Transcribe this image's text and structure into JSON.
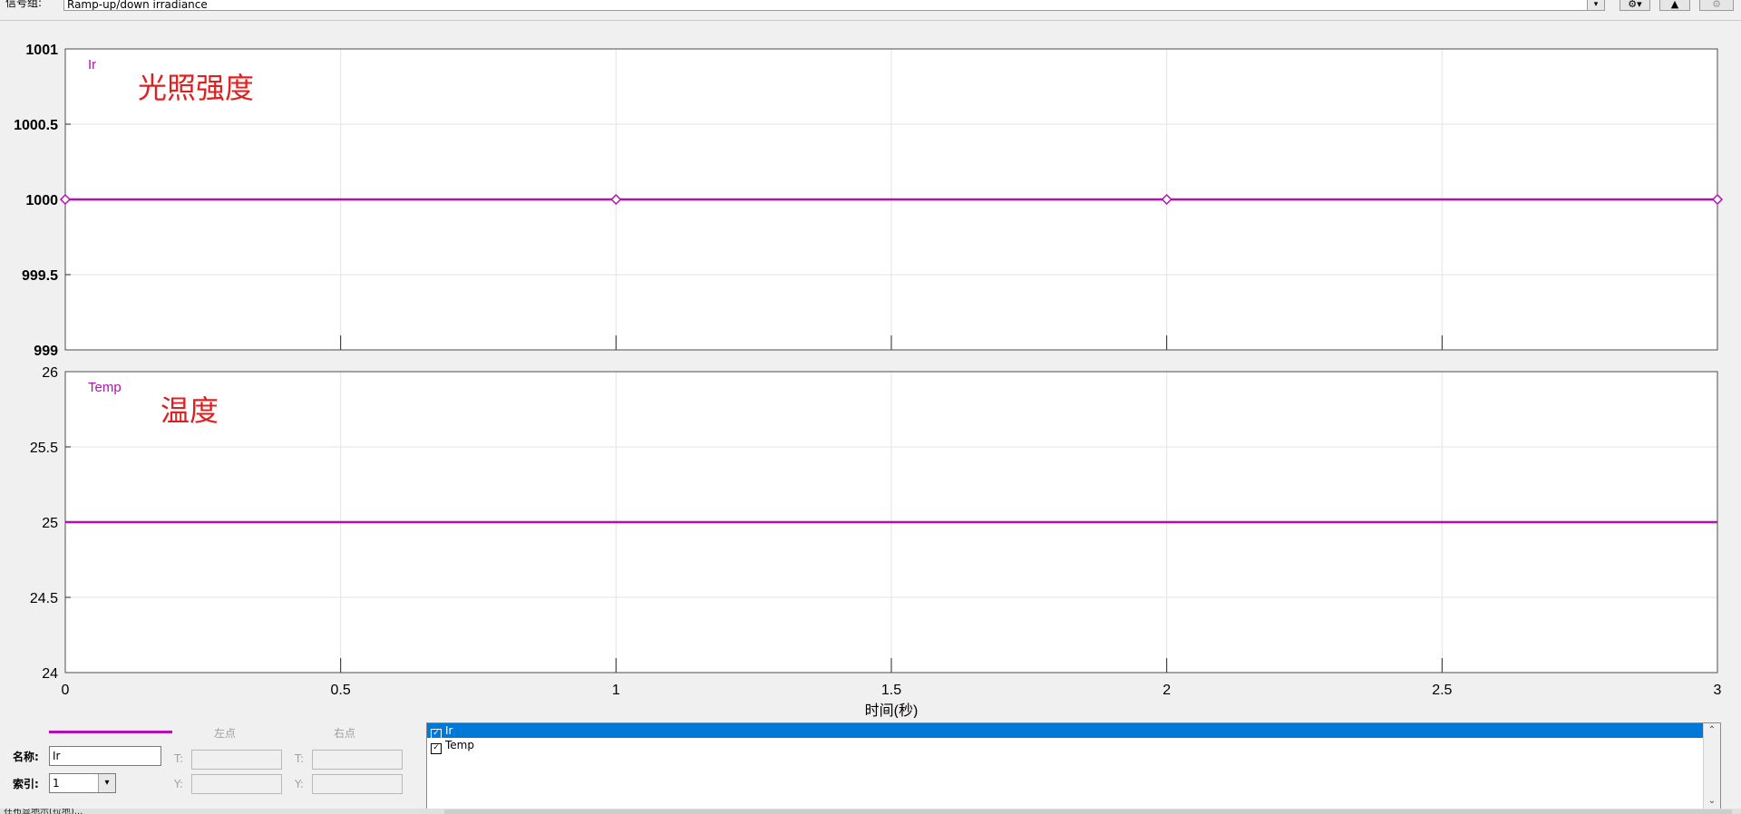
{
  "toolbar": {
    "group_label": "信号组:",
    "group_value": "Ramp-up/down irradiance"
  },
  "plots": [
    {
      "signal": "Ir",
      "annotation": "光照强度",
      "yticks": [
        "1001",
        "1000.5",
        "1000",
        "999.5",
        "999"
      ],
      "ylim": [
        999,
        1001
      ],
      "value": 1000,
      "markers_x": [
        0,
        1,
        2,
        3
      ],
      "color": "#b30fb3",
      "annotation_color": "#e02020"
    },
    {
      "signal": "Temp",
      "annotation": "温度",
      "yticks": [
        "26",
        "25.5",
        "25",
        "24.5",
        "24"
      ],
      "ylim": [
        24,
        26
      ],
      "value": 25,
      "markers_x": [],
      "color": "#b30fb3",
      "annotation_color": "#e02020"
    }
  ],
  "chart_data": {
    "type": "line",
    "x": [
      0,
      3
    ],
    "xlim": [
      0,
      3
    ],
    "xticks": [
      "0",
      "0.5",
      "1",
      "1.5",
      "2",
      "2.5",
      "3"
    ],
    "xlabel": "时间(秒)",
    "grid": true,
    "series": [
      {
        "name": "Ir",
        "values": [
          1000,
          1000
        ],
        "ylim": [
          999,
          1001
        ]
      },
      {
        "name": "Temp",
        "values": [
          25,
          25
        ],
        "ylim": [
          24,
          26
        ]
      }
    ]
  },
  "editor": {
    "left_point": "左点",
    "right_point": "右点",
    "name_label": "名称:",
    "name_value": "Ir",
    "index_label": "索引:",
    "index_value": "1",
    "t_label": "T:",
    "y_label": "Y:"
  },
  "signal_list": [
    {
      "label": "Ir",
      "checked": true,
      "selected": true
    },
    {
      "label": "Temp",
      "checked": true,
      "selected": false
    }
  ],
  "status": {
    "text": "在布显地示(拉地)..."
  }
}
